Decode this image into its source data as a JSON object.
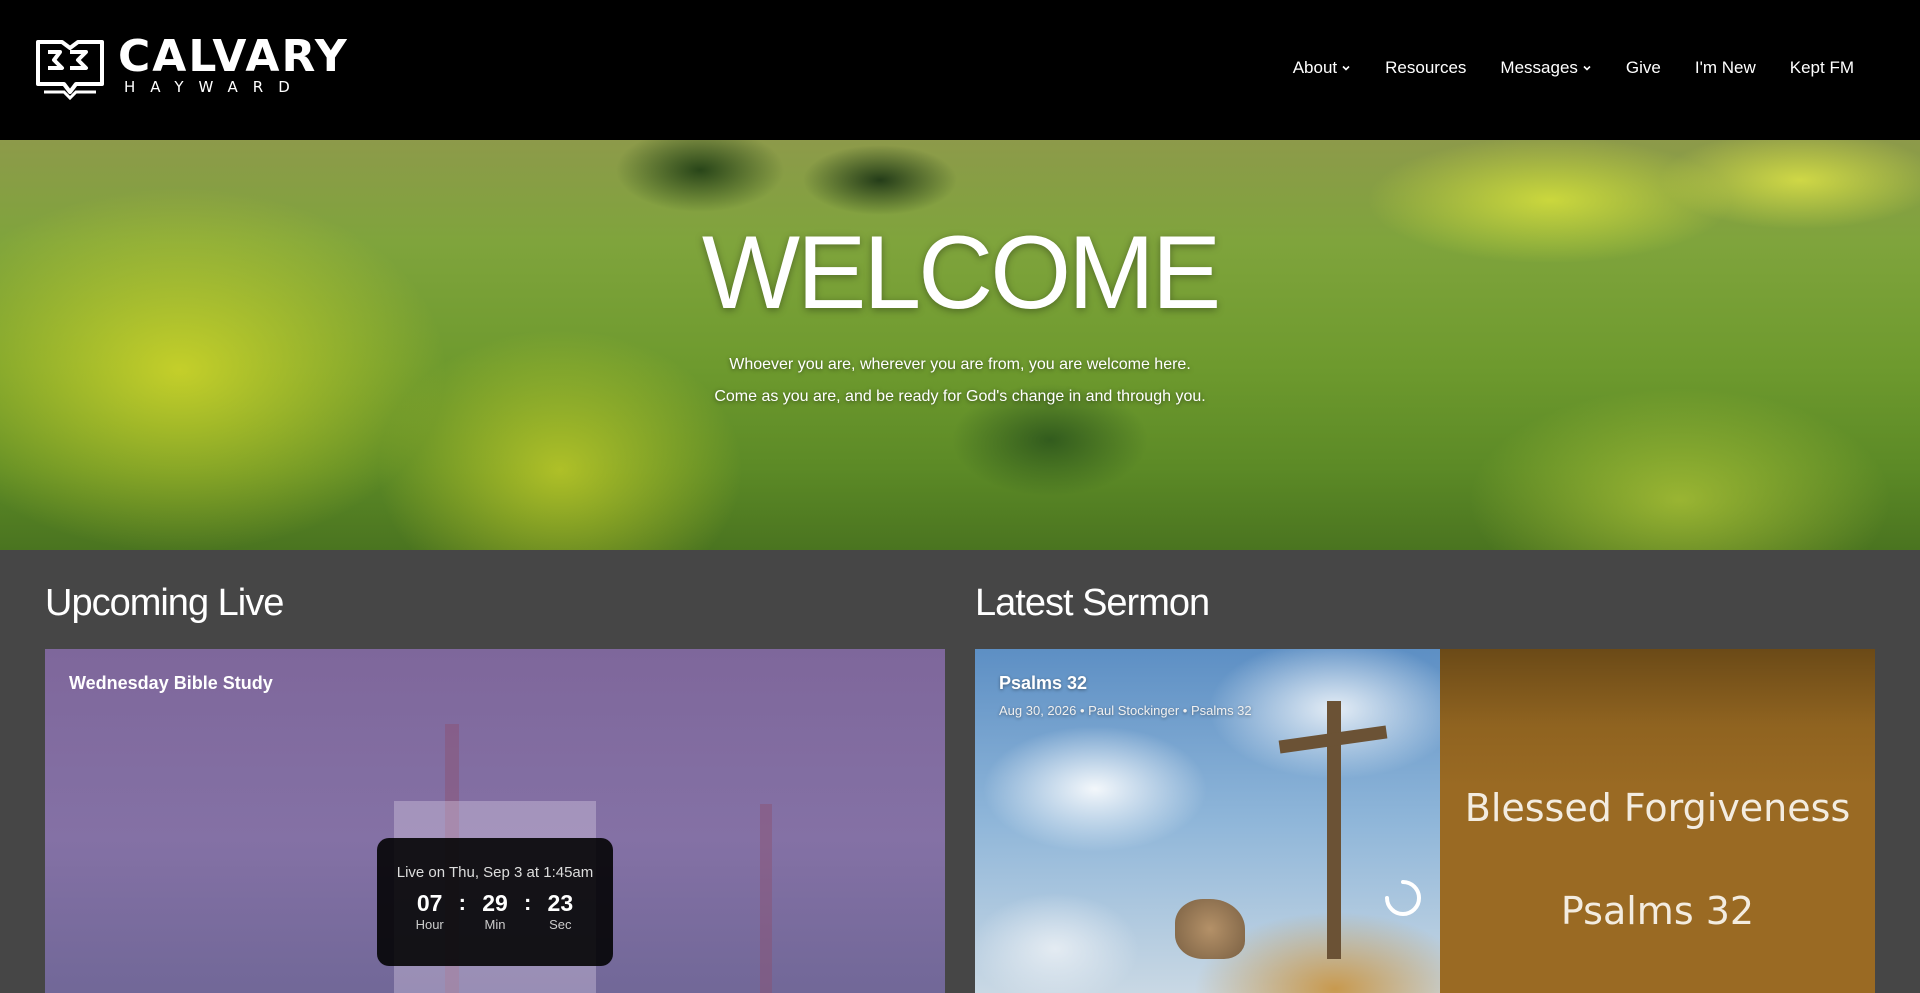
{
  "header": {
    "logo": {
      "name": "CALVARY",
      "sub": "HAYWARD"
    },
    "nav": [
      {
        "label": "About",
        "dropdown": true
      },
      {
        "label": "Resources",
        "dropdown": false
      },
      {
        "label": "Messages",
        "dropdown": true
      },
      {
        "label": "Give",
        "dropdown": false
      },
      {
        "label": "I'm New",
        "dropdown": false
      },
      {
        "label": "Kept FM",
        "dropdown": false
      }
    ]
  },
  "hero": {
    "title": "WELCOME",
    "line1": "Whoever you are, wherever you are from, you are welcome here.",
    "line2": "Come as you are, and be ready for God's change in and through you."
  },
  "upcoming_live": {
    "heading": "Upcoming Live",
    "event_title": "Wednesday Bible Study",
    "countdown": {
      "label": "Live on Thu, Sep 3 at 1:45am",
      "hour": "07",
      "hour_label": "Hour",
      "min": "29",
      "min_label": "Min",
      "sec": "23",
      "sec_label": "Sec"
    }
  },
  "latest_sermon": {
    "heading": "Latest Sermon",
    "title": "Psalms 32",
    "meta": "Aug 30, 2026 • Paul Stockinger • Psalms 32",
    "artwork_text_1": "Blessed Forgiveness",
    "artwork_text_2": "Psalms 32"
  },
  "colors": {
    "header_bg": "#000000",
    "page_bg": "#464646",
    "sermon_panel": "#9a6a23"
  }
}
